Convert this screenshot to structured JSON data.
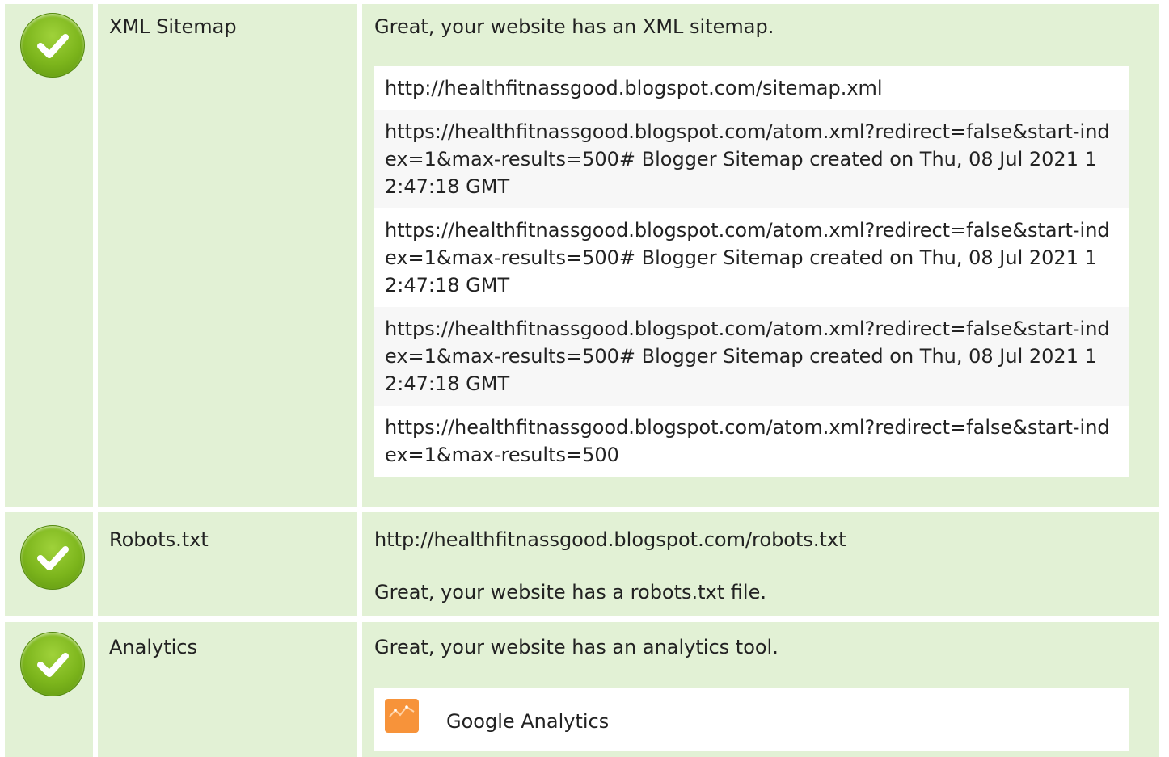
{
  "rows": [
    {
      "icon": "check-circle-icon",
      "name": "XML Sitemap",
      "message": "Great, your website has an XML sitemap.",
      "items": [
        "http://healthfitnassgood.blogspot.com/sitemap.xml",
        "https://healthfitnassgood.blogspot.com/atom.xml?redirect=false&start-index=1&max-results=500# Blogger Sitemap created on Thu, 08 Jul 2021 12:47:18 GMT",
        "https://healthfitnassgood.blogspot.com/atom.xml?redirect=false&start-index=1&max-results=500# Blogger Sitemap created on Thu, 08 Jul 2021 12:47:18 GMT",
        "https://healthfitnassgood.blogspot.com/atom.xml?redirect=false&start-index=1&max-results=500# Blogger Sitemap created on Thu, 08 Jul 2021 12:47:18 GMT",
        "https://healthfitnassgood.blogspot.com/atom.xml?redirect=false&start-index=1&max-results=500"
      ]
    },
    {
      "icon": "check-circle-icon",
      "name": "Robots.txt",
      "url": "http://healthfitnassgood.blogspot.com/robots.txt",
      "message": "Great, your website has a robots.txt file."
    },
    {
      "icon": "check-circle-icon",
      "name": "Analytics",
      "message": "Great, your website has an analytics tool.",
      "tool": {
        "icon": "google-analytics-icon",
        "name": "Google Analytics"
      }
    }
  ],
  "colors": {
    "row_bg": "#e2f1d5",
    "check_green": "#7cb51c",
    "ga_orange": "#f7933a"
  }
}
